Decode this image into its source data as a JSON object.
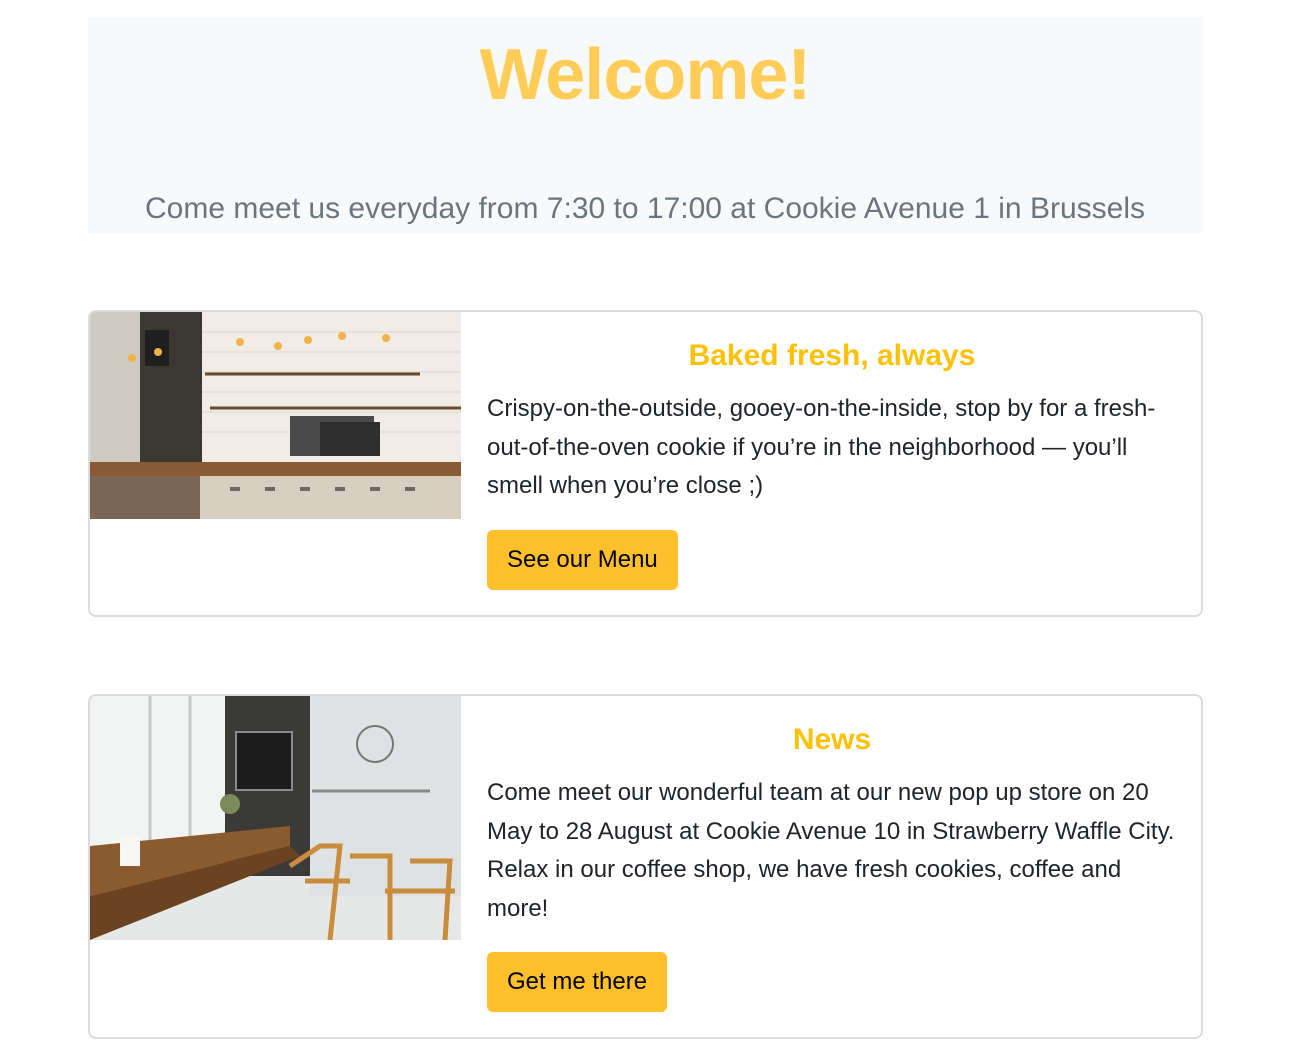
{
  "theme": {
    "hero_title_color": "#ffcd57",
    "hero_background": "#f8f9fa",
    "lead_color": "#6c757d",
    "card_title_color": "#ffc107",
    "button_color": "#ffc02b"
  },
  "hero": {
    "title": "Welcome!",
    "lead": "Come meet us everyday from 7:30 to 17:00 at Cookie Avenue 1 in Brussels"
  },
  "cards": [
    {
      "title": "Baked fresh, always",
      "text": "Crispy-on-the-outside, gooey-on-the-inside, stop by for a fresh-out-of-the-oven cookie if you’re in the neighborhood — you’ll smell when you’re close ;)",
      "button": "See our Menu"
    },
    {
      "title": "News",
      "text": "Come meet our wonderful team at our new pop up store on 20 May to 28 August at Cookie Avenue 10 in Strawberry Waffle City. Relax in our coffee shop, we have fresh cookies, coffee and more!",
      "button": "Get me there"
    }
  ]
}
